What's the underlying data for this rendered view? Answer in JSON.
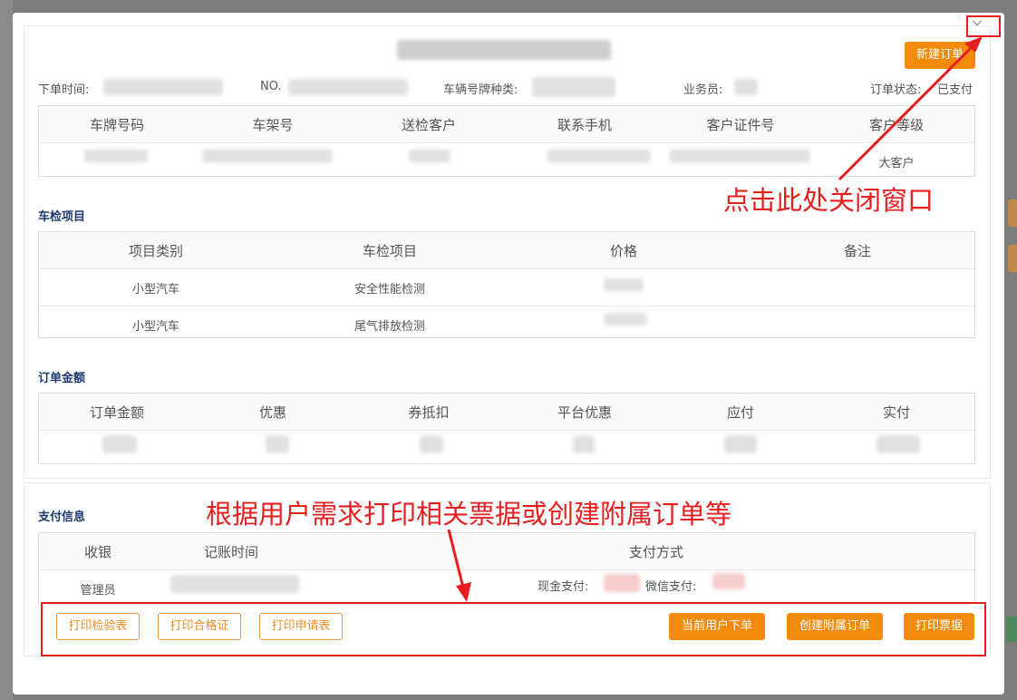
{
  "modal": {
    "close_icon": "×",
    "new_order_label": "新建订单",
    "info": {
      "order_time_label": "下单时间:",
      "no_label": "NO.",
      "plate_type_label": "车辆号牌种类:",
      "salesman_label": "业务员:",
      "status_label": "订单状态:",
      "status_value": "已支付"
    },
    "vehicle_table": {
      "headers": [
        "车牌号码",
        "车架号",
        "送检客户",
        "联系手机",
        "客户证件号",
        "客户等级"
      ],
      "row": [
        "",
        "",
        "",
        "",
        "",
        "大客户"
      ]
    },
    "inspection": {
      "title": "车检项目",
      "headers": [
        "项目类别",
        "车检项目",
        "价格",
        "备注"
      ],
      "rows": [
        [
          "小型汽车",
          "安全性能检测",
          "",
          ""
        ],
        [
          "小型汽车",
          "尾气排放检测",
          "",
          ""
        ]
      ]
    },
    "amount": {
      "title": "订单金额",
      "headers": [
        "订单金额",
        "优惠",
        "券抵扣",
        "平台优惠",
        "应付",
        "实付"
      ]
    },
    "payment": {
      "title": "支付信息",
      "headers": [
        "收银",
        "记账时间",
        "支付方式"
      ],
      "row": {
        "cashier": "管理员",
        "cash_label": "现金支付:",
        "wechat_label": "微信支付:"
      }
    },
    "actions": {
      "print_inspection": "打印检验表",
      "print_certificate": "打印合格证",
      "print_application": "打印申请表",
      "current_user_order": "当前用户下单",
      "create_sub_order": "创建附属订单",
      "print_receipt": "打印票据"
    }
  },
  "annotations": {
    "close_hint": "点击此处关闭窗口",
    "print_hint": "根据用户需求打印相关票据或创建附属订单等",
    "color": "#e61e1e"
  },
  "colors": {
    "accent": "#f28b0b",
    "section_title": "#1f3a6e"
  }
}
